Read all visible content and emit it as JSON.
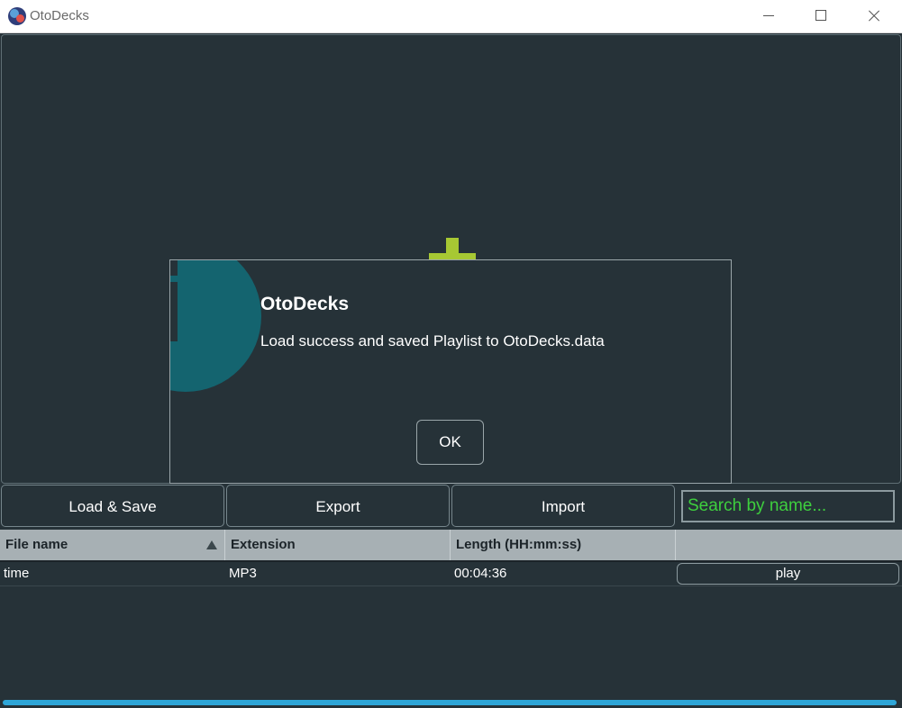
{
  "window": {
    "title": "OtoDecks",
    "controls": {
      "minimize_icon": "minimize-icon",
      "maximize_icon": "maximize-icon",
      "close_icon": "close-icon"
    }
  },
  "toolbar": {
    "load_save_label": "Load & Save",
    "export_label": "Export",
    "import_label": "Import",
    "search_placeholder": "Search by name..."
  },
  "playlist": {
    "columns": [
      "File name",
      "Extension",
      "Length (HH:mm:ss)",
      ""
    ],
    "sort_indicator": "ascending",
    "rows": [
      {
        "file_name": "time",
        "extension": "MP3",
        "length": "00:04:36",
        "action": "play"
      }
    ]
  },
  "dialog": {
    "icon": "info-icon",
    "title": "OtoDecks",
    "message": "Load success and saved Playlist to OtoDecks.data",
    "ok_label": "OK"
  },
  "colors": {
    "background": "#263238",
    "accent_green": "#a7c833",
    "search_text": "#3ecf3e",
    "info_teal": "#14646f",
    "scrollbar": "#2ea6d8"
  }
}
